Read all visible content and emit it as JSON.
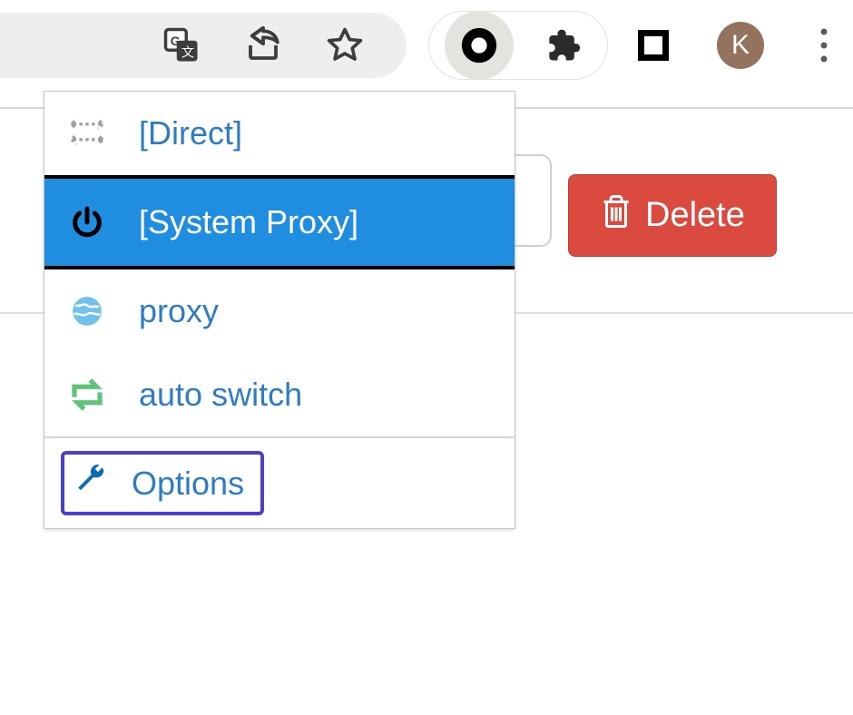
{
  "toolbar": {
    "avatar_initial": "K"
  },
  "page": {
    "delete_label": "Delete"
  },
  "popup": {
    "items": [
      {
        "label": "[Direct]"
      },
      {
        "label": "[System Proxy]"
      },
      {
        "label": "proxy"
      },
      {
        "label": "auto switch"
      }
    ],
    "options_label": "Options"
  }
}
